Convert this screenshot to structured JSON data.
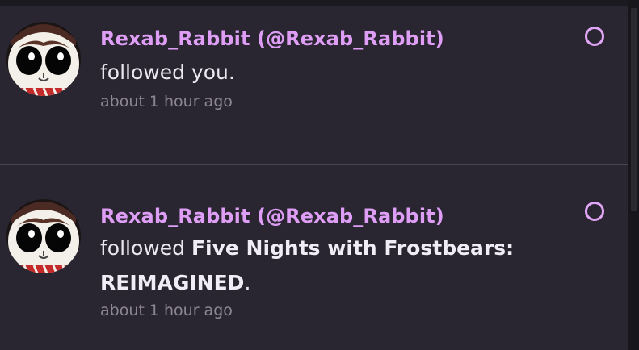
{
  "notifications": [
    {
      "user_display": "Rexab_Rabbit (@Rexab_Rabbit)",
      "action": "followed you.",
      "time": "about 1 hour ago",
      "unread": true
    },
    {
      "user_display": "Rexab_Rabbit (@Rexab_Rabbit)",
      "action_prefix": "followed ",
      "target_line1": "Five Nights with Frostbears:",
      "target_line2": "REIMAGINED",
      "action_suffix": ".",
      "time": "about 1 hour ago",
      "unread": true
    }
  ],
  "colors": {
    "accent": "#df9ef5",
    "background": "#2a2631",
    "text": "#ece8f1",
    "muted": "#8d8795"
  },
  "icons": {
    "unread": "unread-circle-icon",
    "avatar": "avatar-bunny-mascot"
  }
}
